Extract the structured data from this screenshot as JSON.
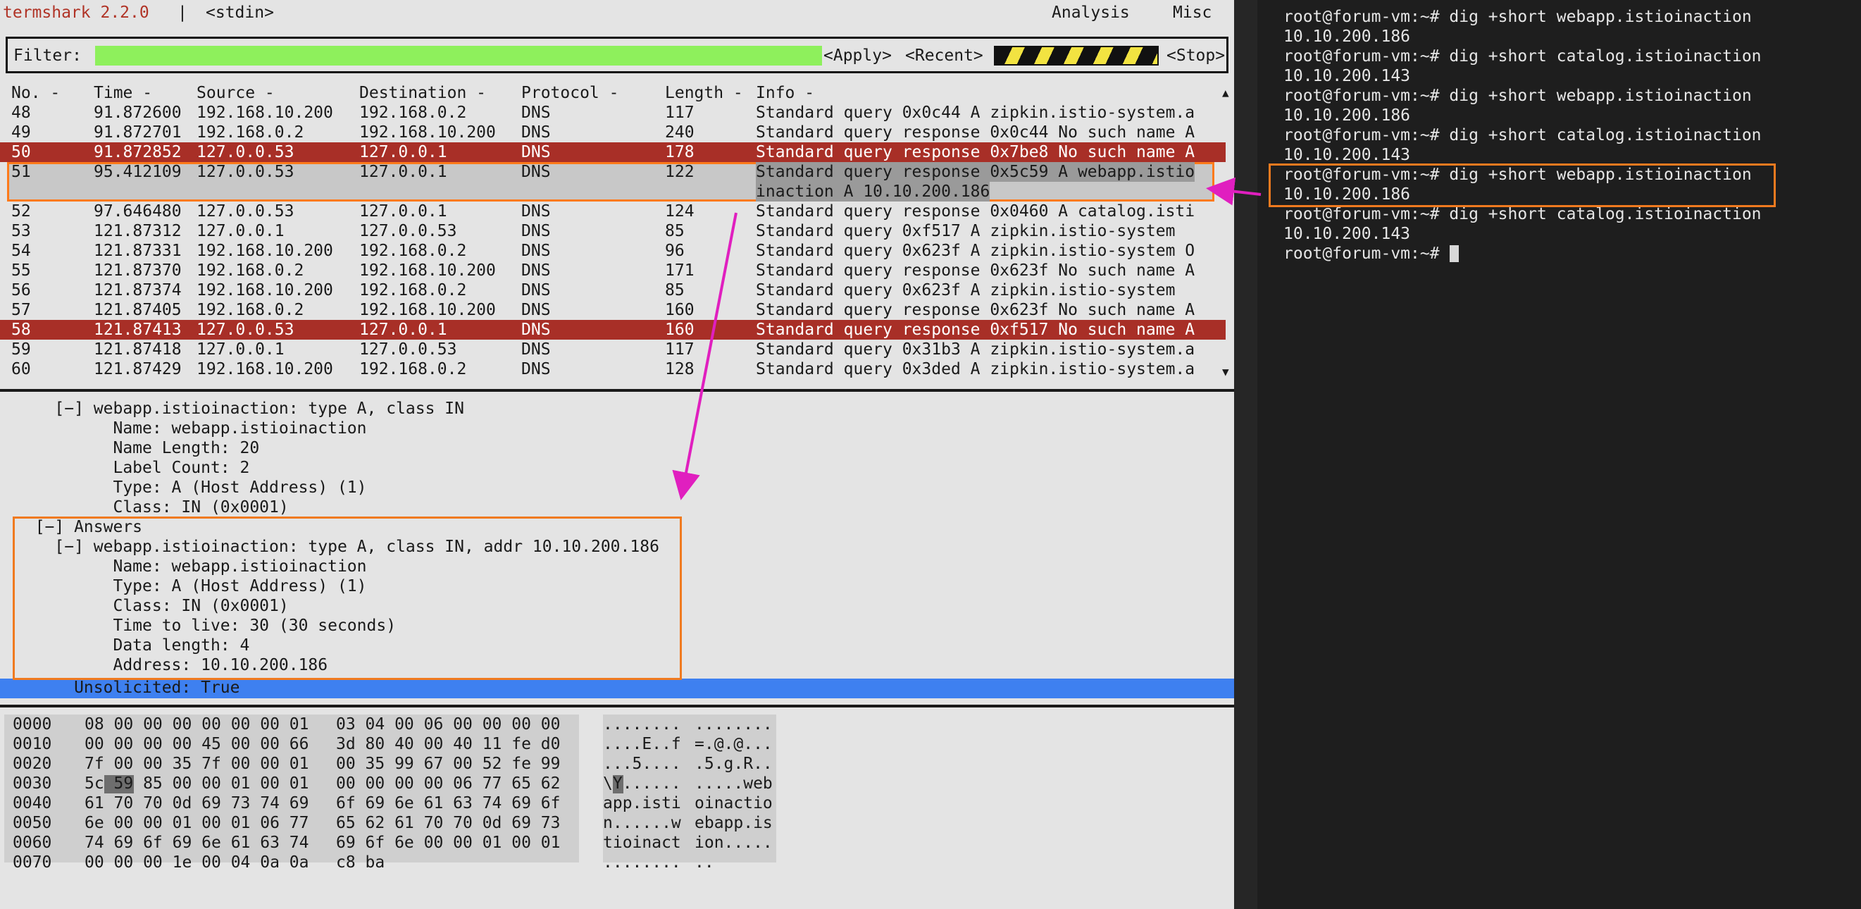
{
  "app": {
    "title": "termshark 2.2.0",
    "separator": "|",
    "source": "<stdin>",
    "menu": [
      "Analysis",
      "Misc"
    ]
  },
  "filter": {
    "label": "Filter:",
    "value": "",
    "apply": "<Apply>",
    "recent": "<Recent>",
    "stop": "<Stop>"
  },
  "packet_list": {
    "columns": [
      "No. -",
      "Time -",
      "Source -",
      "Destination -",
      "Protocol -",
      "Length -",
      "Info -"
    ],
    "rows": [
      {
        "no": "48",
        "time": "91.872600",
        "src": "192.168.10.200",
        "dst": "192.168.0.2",
        "proto": "DNS",
        "len": "117",
        "info": "Standard query 0x0c44 A zipkin.istio-system.a",
        "style": "normal"
      },
      {
        "no": "49",
        "time": "91.872701",
        "src": "192.168.0.2",
        "dst": "192.168.10.200",
        "proto": "DNS",
        "len": "240",
        "info": "Standard query response 0x0c44 No such name A",
        "style": "normal"
      },
      {
        "no": "50",
        "time": "91.872852",
        "src": "127.0.0.53",
        "dst": "127.0.0.1",
        "proto": "DNS",
        "len": "178",
        "info": "Standard query response 0x7be8 No such name A",
        "style": "error"
      },
      {
        "no": "51",
        "time": "95.412109",
        "src": "127.0.0.53",
        "dst": "127.0.0.1",
        "proto": "DNS",
        "len": "122",
        "info": "Standard query response 0x5c59 A webapp.istio",
        "info2": "inaction A 10.10.200.186",
        "style": "selected"
      },
      {
        "no": "52",
        "time": "97.646480",
        "src": "127.0.0.53",
        "dst": "127.0.0.1",
        "proto": "DNS",
        "len": "124",
        "info": "Standard query response 0x0460 A catalog.isti",
        "style": "normal"
      },
      {
        "no": "53",
        "time": "121.87312",
        "src": "127.0.0.1",
        "dst": "127.0.0.53",
        "proto": "DNS",
        "len": "85",
        "info": "Standard query 0xf517 A zipkin.istio-system",
        "style": "normal"
      },
      {
        "no": "54",
        "time": "121.87331",
        "src": "192.168.10.200",
        "dst": "192.168.0.2",
        "proto": "DNS",
        "len": "96",
        "info": "Standard query 0x623f A zipkin.istio-system O",
        "style": "normal"
      },
      {
        "no": "55",
        "time": "121.87370",
        "src": "192.168.0.2",
        "dst": "192.168.10.200",
        "proto": "DNS",
        "len": "171",
        "info": "Standard query response 0x623f No such name A",
        "style": "normal"
      },
      {
        "no": "56",
        "time": "121.87374",
        "src": "192.168.10.200",
        "dst": "192.168.0.2",
        "proto": "DNS",
        "len": "85",
        "info": "Standard query 0x623f A zipkin.istio-system",
        "style": "normal"
      },
      {
        "no": "57",
        "time": "121.87405",
        "src": "192.168.0.2",
        "dst": "192.168.10.200",
        "proto": "DNS",
        "len": "160",
        "info": "Standard query response 0x623f No such name A",
        "style": "normal"
      },
      {
        "no": "58",
        "time": "121.87413",
        "src": "127.0.0.53",
        "dst": "127.0.0.1",
        "proto": "DNS",
        "len": "160",
        "info": "Standard query response 0xf517 No such name A",
        "style": "error"
      },
      {
        "no": "59",
        "time": "121.87418",
        "src": "127.0.0.1",
        "dst": "127.0.0.53",
        "proto": "DNS",
        "len": "117",
        "info": "Standard query 0x31b3 A zipkin.istio-system.a",
        "style": "normal"
      },
      {
        "no": "60",
        "time": "121.87429",
        "src": "192.168.10.200",
        "dst": "192.168.0.2",
        "proto": "DNS",
        "len": "128",
        "info": "Standard query 0x3ded A zipkin.istio-system.a",
        "style": "normal"
      }
    ]
  },
  "detail": {
    "lines": [
      "    [−] webapp.istioinaction: type A, class IN",
      "          Name: webapp.istioinaction",
      "          Name Length: 20",
      "          Label Count: 2",
      "          Type: A (Host Address) (1)",
      "          Class: IN (0x0001)",
      "  [−] Answers",
      "    [−] webapp.istioinaction: type A, class IN, addr 10.10.200.186",
      "          Name: webapp.istioinaction",
      "          Type: A (Host Address) (1)",
      "          Class: IN (0x0001)",
      "          Time to live: 30 (30 seconds)",
      "          Data length: 4",
      "          Address: 10.10.200.186",
      "      Unsolicited: True"
    ]
  },
  "hex": {
    "rows": [
      {
        "off": "0000",
        "a": "08 00 00 00 00 00 00 01",
        "b": "03 04 00 06 00 00 00 00",
        "asc_a": "........",
        "asc_b": "........"
      },
      {
        "off": "0010",
        "a": "00 00 00 00 45 00 00 66",
        "b": "3d 80 40 00 40 11 fe d0",
        "asc_a": "....E..f",
        "asc_b": "=.@.@..."
      },
      {
        "off": "0020",
        "a": "7f 00 00 35 7f 00 00 01",
        "b": "00 35 99 67 00 52 fe 99",
        "asc_a": "...5....",
        "asc_b": ".5.g.R.."
      },
      {
        "off": "0030",
        "a": "5c 59 85 00 00 01 00 01",
        "b": "00 00 00 00 06 77 65 62",
        "asc_a": "\\Y......",
        "asc_b": ".....web"
      },
      {
        "off": "0040",
        "a": "61 70 70 0d 69 73 74 69",
        "b": "6f 69 6e 61 63 74 69 6f",
        "asc_a": "app.isti",
        "asc_b": "oinactio"
      },
      {
        "off": "0050",
        "a": "6e 00 00 01 00 01 06 77",
        "b": "65 62 61 70 70 0d 69 73",
        "asc_a": "n......w",
        "asc_b": "ebapp.is"
      },
      {
        "off": "0060",
        "a": "74 69 6f 69 6e 61 63 74",
        "b": "69 6f 6e 00 00 01 00 01",
        "asc_a": "tioinact",
        "asc_b": "ion....."
      },
      {
        "off": "0070",
        "a": "00 00 00 1e 00 04 0a 0a",
        "b": "c8 ba",
        "asc_a": "........",
        "asc_b": ".."
      }
    ]
  },
  "terminal": {
    "lines": [
      "root@forum-vm:~# dig +short webapp.istioinaction",
      "10.10.200.186",
      "root@forum-vm:~# dig +short catalog.istioinaction",
      "10.10.200.143",
      "root@forum-vm:~# dig +short webapp.istioinaction",
      "10.10.200.186",
      "root@forum-vm:~# dig +short catalog.istioinaction",
      "10.10.200.143",
      "root@forum-vm:~# dig +short webapp.istioinaction",
      "10.10.200.186",
      "root@forum-vm:~# dig +short catalog.istioinaction",
      "10.10.200.143",
      "root@forum-vm:~# "
    ]
  },
  "colors": {
    "app_title": "#b03326",
    "filter_valid": "#8ef05c",
    "error_row": "#a82f27",
    "highlight_box": "#f07a1f",
    "annotation_arrow": "#e01fbf",
    "selection_bar": "#3e80f0"
  }
}
